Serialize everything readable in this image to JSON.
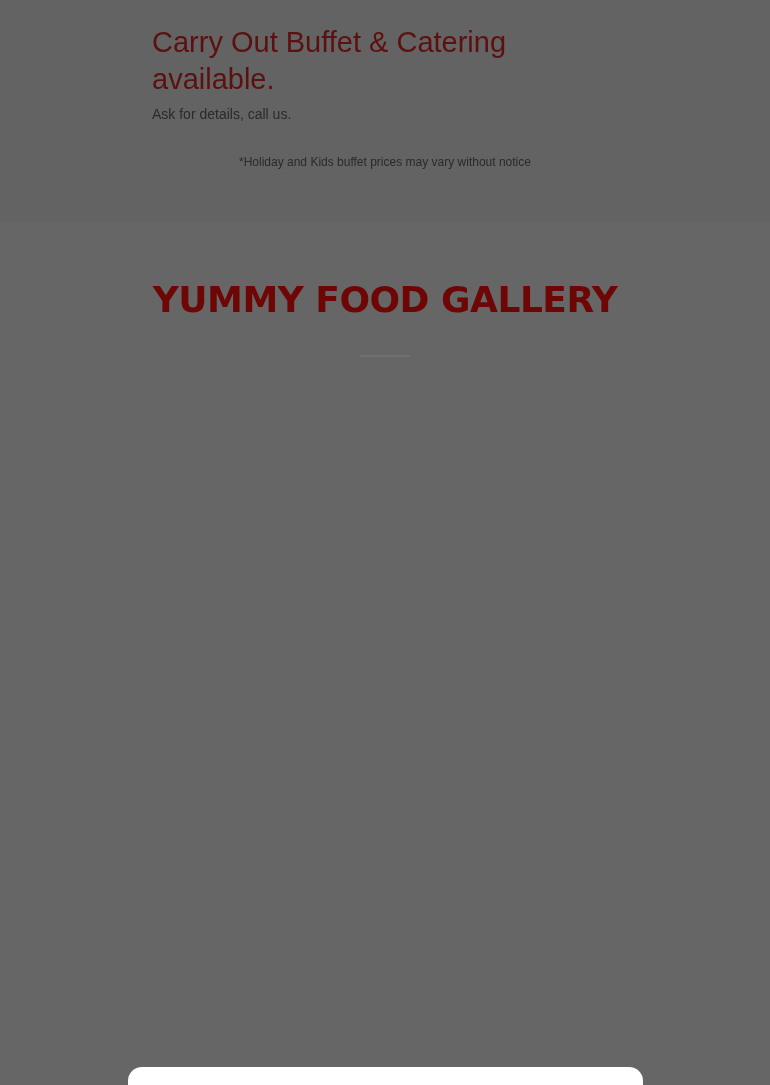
{
  "catering": {
    "heading": "Carry Out Buffet & Catering available.",
    "text": "Ask for details, call us.",
    "note": "*Holiday and Kids buffet prices may vary without notice"
  },
  "gallery": {
    "title": "YUMMY FOOD GALLERY"
  },
  "modal": {
    "kind": "dialog"
  }
}
